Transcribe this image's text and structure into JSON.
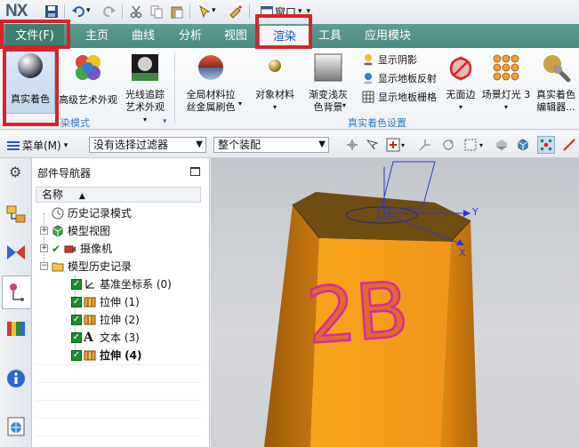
{
  "app": {
    "logo": "NX",
    "window_menu": "窗口"
  },
  "tabs": [
    {
      "label": "文件(F)"
    },
    {
      "label": "主页"
    },
    {
      "label": "曲线"
    },
    {
      "label": "分析"
    },
    {
      "label": "视图"
    },
    {
      "label": "渲染"
    },
    {
      "label": "工具"
    },
    {
      "label": "应用模块"
    }
  ],
  "ribbon": {
    "true_shading": "真实着色",
    "artistic": "高级艺术外观",
    "raytrace_line1": "光线追踪",
    "raytrace_line2": "艺术外观",
    "global_mat_line1": "全局材料拉",
    "global_mat_line2": "丝金属刷色",
    "object_material": "对象材料",
    "gradient_line1": "渐变浅灰",
    "gradient_line2": "色背景",
    "show_shadow": "显示阴影",
    "show_floor_reflect": "显示地板反射",
    "show_floor_grid": "显示地板栅格",
    "no_face_edge": "无面边",
    "scene_light": "场景灯光 3",
    "shading_editor_line1": "真实着色",
    "shading_editor_line2": "编辑器...",
    "group1_label": "染模式",
    "group2_label": "真实着色设置"
  },
  "selbar": {
    "menu": "菜单(M)",
    "filter": "没有选择过滤器",
    "scope": "整个装配"
  },
  "navigator": {
    "title": "部件导航器",
    "column": "名称",
    "items": [
      {
        "label": "历史记录模式"
      },
      {
        "label": "模型视图"
      },
      {
        "label": "摄像机"
      },
      {
        "label": "模型历史记录"
      },
      {
        "label": "基准坐标系 (0)"
      },
      {
        "label": "拉伸 (1)"
      },
      {
        "label": "拉伸 (2)"
      },
      {
        "label": "文本 (3)"
      },
      {
        "label": "拉伸 (4)"
      }
    ]
  },
  "viewport": {
    "engraved_text": "2B",
    "axis_y": "Y",
    "axis_x": "X",
    "colors": {
      "body": "#f29a12",
      "top": "#6b4a10",
      "text_outline": "#d62aa8"
    }
  }
}
